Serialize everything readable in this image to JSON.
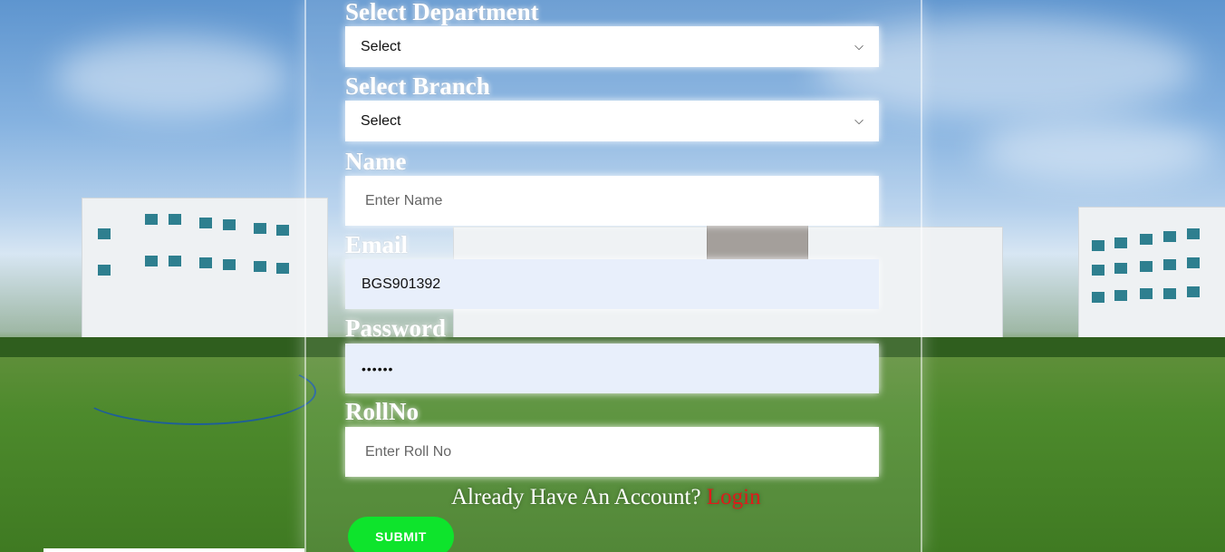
{
  "form": {
    "department": {
      "label": "Select Department",
      "selected": "Select"
    },
    "branch": {
      "label": "Select Branch",
      "selected": "Select"
    },
    "name": {
      "label": "Name",
      "placeholder": "Enter Name",
      "value": ""
    },
    "email": {
      "label": "Email",
      "value": "BGS901392"
    },
    "password": {
      "label": "Password",
      "value": "••••••"
    },
    "rollno": {
      "label": "RollNo",
      "placeholder": "Enter Roll No",
      "value": ""
    },
    "account_prompt": "Already Have An Account?",
    "login_link": "Login",
    "submit_label": "SUBMIT"
  },
  "colors": {
    "submit_bg": "#0ee42c",
    "login_link": "#e01a1a",
    "autofill_bg": "#e8effb"
  },
  "icons": {
    "select_chevron": "chevron-down-icon"
  }
}
